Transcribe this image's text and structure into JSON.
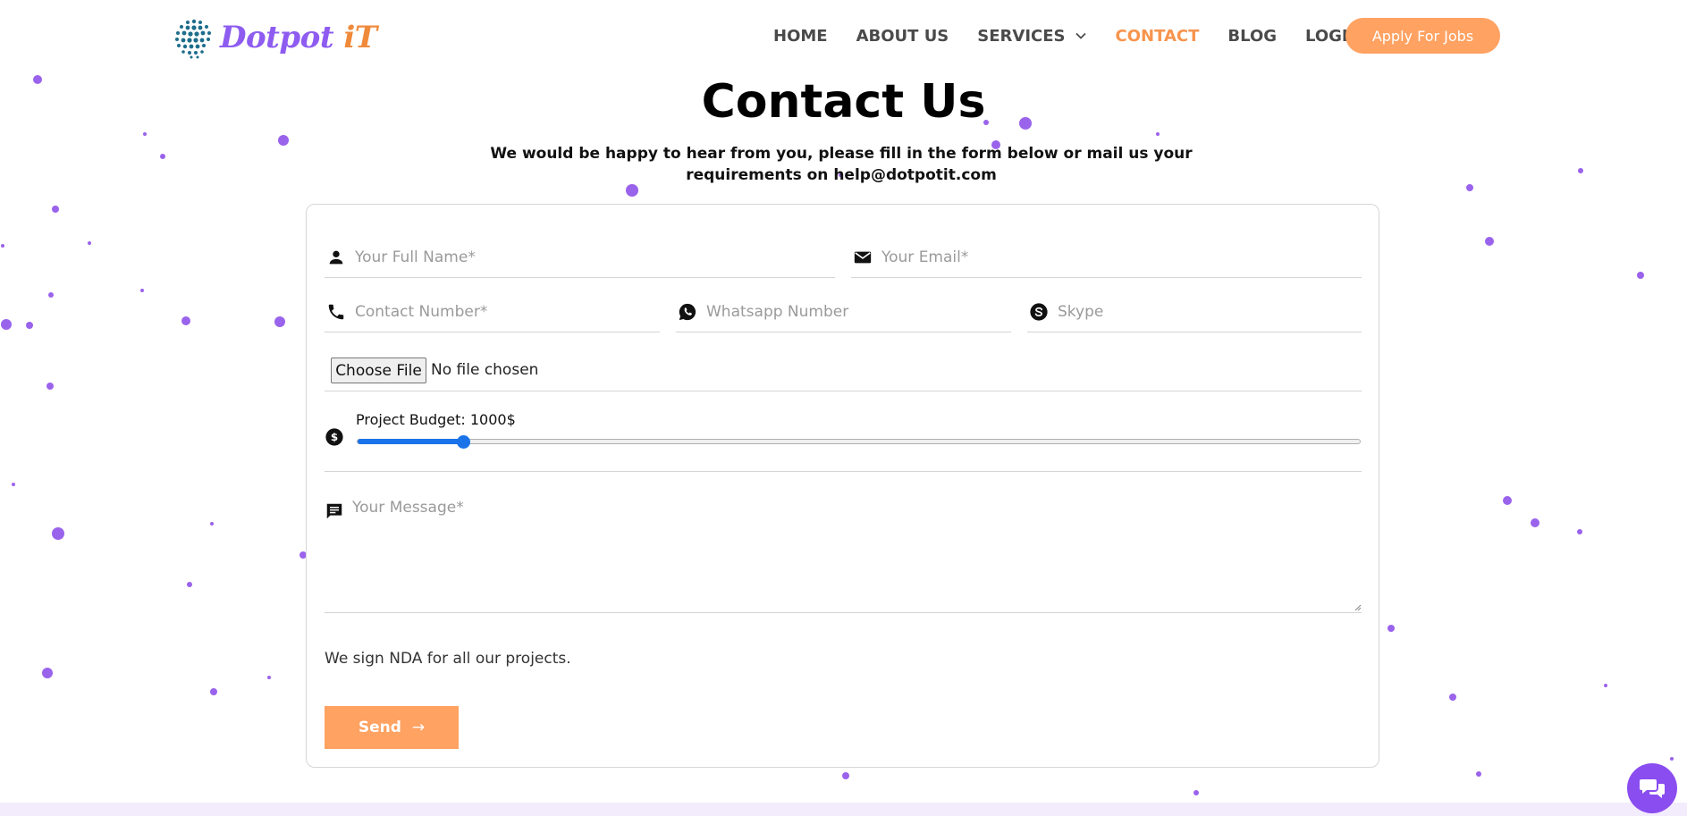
{
  "brand": {
    "name": "Dotpot",
    "suffix": "iT",
    "primary_color": "#8e5cf0",
    "accent_color": "#f7944d"
  },
  "nav": {
    "items": [
      {
        "label": "HOME",
        "active": false
      },
      {
        "label": "ABOUT US",
        "active": false
      },
      {
        "label": "SERVICES",
        "active": false,
        "has_dropdown": true
      },
      {
        "label": "CONTACT",
        "active": true
      },
      {
        "label": "BLOG",
        "active": false
      },
      {
        "label": "LOGIN",
        "active": false
      }
    ],
    "cta_label": "Apply For Jobs"
  },
  "hero": {
    "title": "Contact Us",
    "subtitle": "We would be happy to hear from you, please fill in the form below or mail us your requirements on help@dotpotit.com"
  },
  "form": {
    "full_name_placeholder": "Your Full Name*",
    "email_placeholder": "Your Email*",
    "contact_placeholder": "Contact Number*",
    "whatsapp_placeholder": "Whatsapp Number",
    "skype_placeholder": "Skype",
    "file_button_label": "Choose File",
    "file_status": "No file chosen",
    "budget_label": "Project Budget: 1000$",
    "budget_fraction": 0.105,
    "message_placeholder": "Your Message*",
    "nda_text": "We sign NDA for all our projects.",
    "send_label": "Send",
    "send_arrow": "→"
  },
  "icons": {
    "chat": "chat-bubbles-icon"
  }
}
